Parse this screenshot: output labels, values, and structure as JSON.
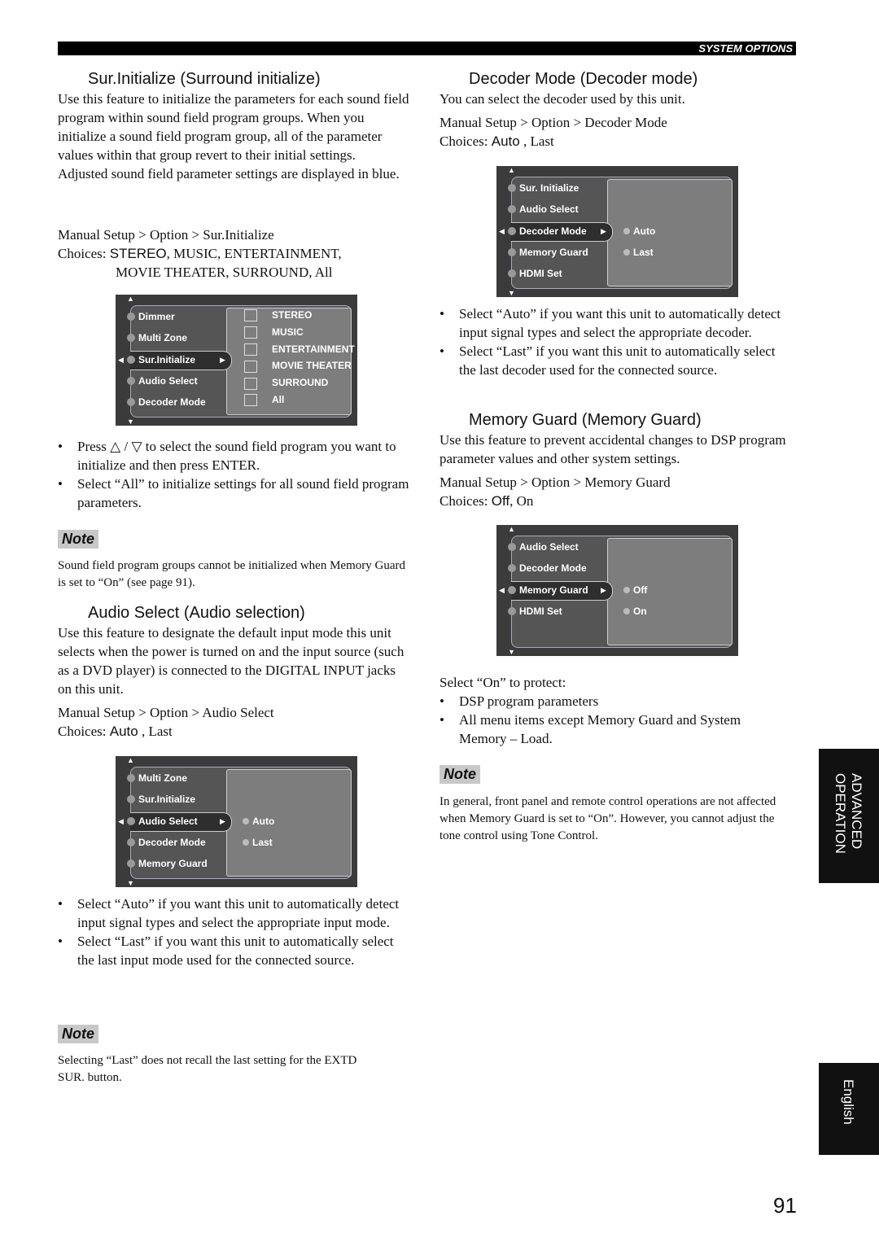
{
  "header": {
    "section": "SYSTEM OPTIONS"
  },
  "sur": {
    "title": "Sur.Initialize (Surround initialize)",
    "para1": "Use this feature to initialize the parameters for each sound field program within sound field program groups. When you initialize a sound field program group, all of the parameter values within that group revert to their initial settings.",
    "para2": "Adjusted sound field parameter settings are displayed in blue.",
    "path": "Manual Setup > Option > Sur.Initialize",
    "choices_label": "Choices: ",
    "choices_default": "STEREO",
    "choices_rest": ", MUSIC, ENTERTAINMENT,",
    "choices_rest2": "MOVIE THEATER, SURROUND, All",
    "bullets": [
      "Press △ / ▽ to select the sound field program you want to initialize and then press ENTER.",
      "Select “All” to initialize settings for all sound field program parameters."
    ],
    "note_label": "Note",
    "note": "Sound field program groups cannot be initialized when Memory Guard is set to “On” (see page 91)."
  },
  "audio": {
    "title": "Audio Select (Audio selection)",
    "para": "Use this feature to designate the default input mode this unit selects when the power is turned on and the input source (such as a DVD player) is connected to the DIGITAL INPUT jacks on this unit.",
    "path": "Manual Setup > Option > Audio Select",
    "choices_label": "Choices: ",
    "choices_default": "Auto",
    "choices_rest": " , Last",
    "bullets": [
      "Select “Auto” if you want this unit to automatically detect input signal types and select the appropriate input mode.",
      "Select “Last” if you want this unit to automatically select the last input mode used for the connected source."
    ],
    "note_label": "Note",
    "note": "Selecting “Last” does not recall the last setting for the EXTD SUR. button."
  },
  "decoder": {
    "title": "Decoder Mode (Decoder mode)",
    "para": "You can select the decoder used by this unit.",
    "path": "Manual Setup > Option > Decoder Mode",
    "choices_label": "Choices: ",
    "choices_default": "Auto",
    "choices_rest": " , Last",
    "bullets": [
      "Select “Auto” if you want this unit to automatically detect input signal types and select the appropriate decoder.",
      "Select “Last” if you want this unit to automatically select the last decoder used for the connected source."
    ]
  },
  "memory": {
    "title": "Memory Guard (Memory Guard)",
    "para": "Use this feature to prevent accidental changes to DSP program parameter values and other system settings.",
    "path": "Manual Setup > Option > Memory Guard",
    "choices_label": "Choices: ",
    "choices_default": "Off",
    "choices_rest": ", On",
    "protect": "Select “On” to protect:",
    "bullets": [
      "DSP program parameters",
      "All menu items except Memory Guard and System Memory – Load."
    ],
    "note_label": "Note",
    "note": "In general, front panel and remote control operations are not affected when Memory Guard is set to “On”. However, you cannot adjust the tone control using Tone Control."
  },
  "screens": [
    {
      "id": "sur",
      "items": [
        "Dimmer",
        "Multi Zone",
        "Sur.Initialize",
        "Audio Select",
        "Decoder Mode"
      ],
      "selected": 2,
      "options": [
        "STEREO",
        "MUSIC",
        "ENTERTAINMENT",
        "MOVIE THEATER",
        "SURROUND",
        "All"
      ],
      "option_icon": "box"
    },
    {
      "id": "decoder",
      "items": [
        "Sur. Initialize",
        "Audio Select",
        "Decoder Mode",
        "Memory Guard",
        "HDMI Set"
      ],
      "selected": 2,
      "options": [
        "Auto",
        "Last"
      ],
      "option_icon": "dot"
    },
    {
      "id": "memory",
      "items": [
        "Audio Select",
        "Decoder Mode",
        "Memory Guard",
        "HDMI Set"
      ],
      "selected": 2,
      "options": [
        "Off",
        "On"
      ],
      "option_icon": "dot"
    },
    {
      "id": "audio",
      "items": [
        "Multi Zone",
        "Sur.Initialize",
        "Audio Select",
        "Decoder Mode",
        "Memory Guard"
      ],
      "selected": 2,
      "options": [
        "Auto",
        "Last"
      ],
      "option_icon": "dot"
    }
  ],
  "side_tabs": {
    "advanced": "ADVANCED OPERATION",
    "english": "English"
  },
  "page_number": "91"
}
